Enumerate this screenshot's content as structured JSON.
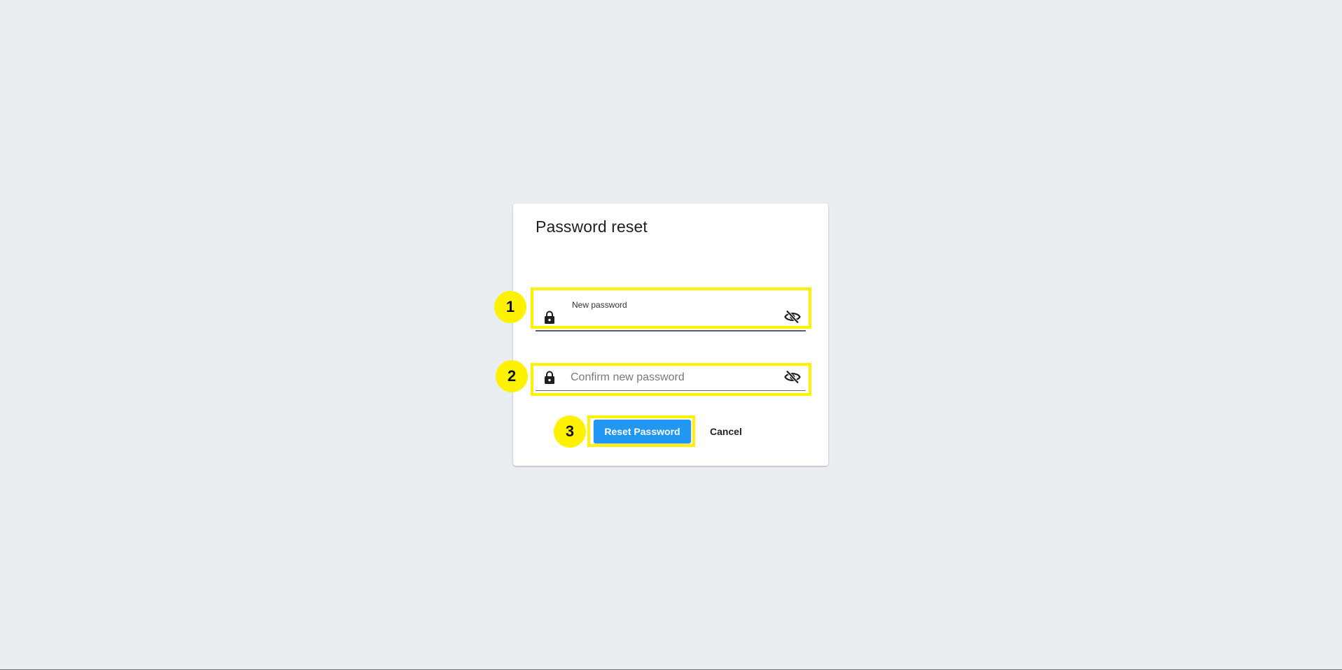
{
  "dialog": {
    "title": "Password reset"
  },
  "new_password": {
    "label": "New password",
    "value": "",
    "icon": "lock-icon",
    "toggle_icon": "eye-off-icon"
  },
  "confirm_password": {
    "placeholder": "Confirm new password",
    "value": "",
    "icon": "lock-icon",
    "toggle_icon": "eye-off-icon"
  },
  "actions": {
    "reset_label": "Reset Password",
    "cancel_label": "Cancel"
  },
  "annotations": {
    "markers": [
      "1",
      "2",
      "3"
    ],
    "highlight_color": "#fff200"
  },
  "colors": {
    "background": "#e9eef2",
    "primary": "#2196f3"
  }
}
